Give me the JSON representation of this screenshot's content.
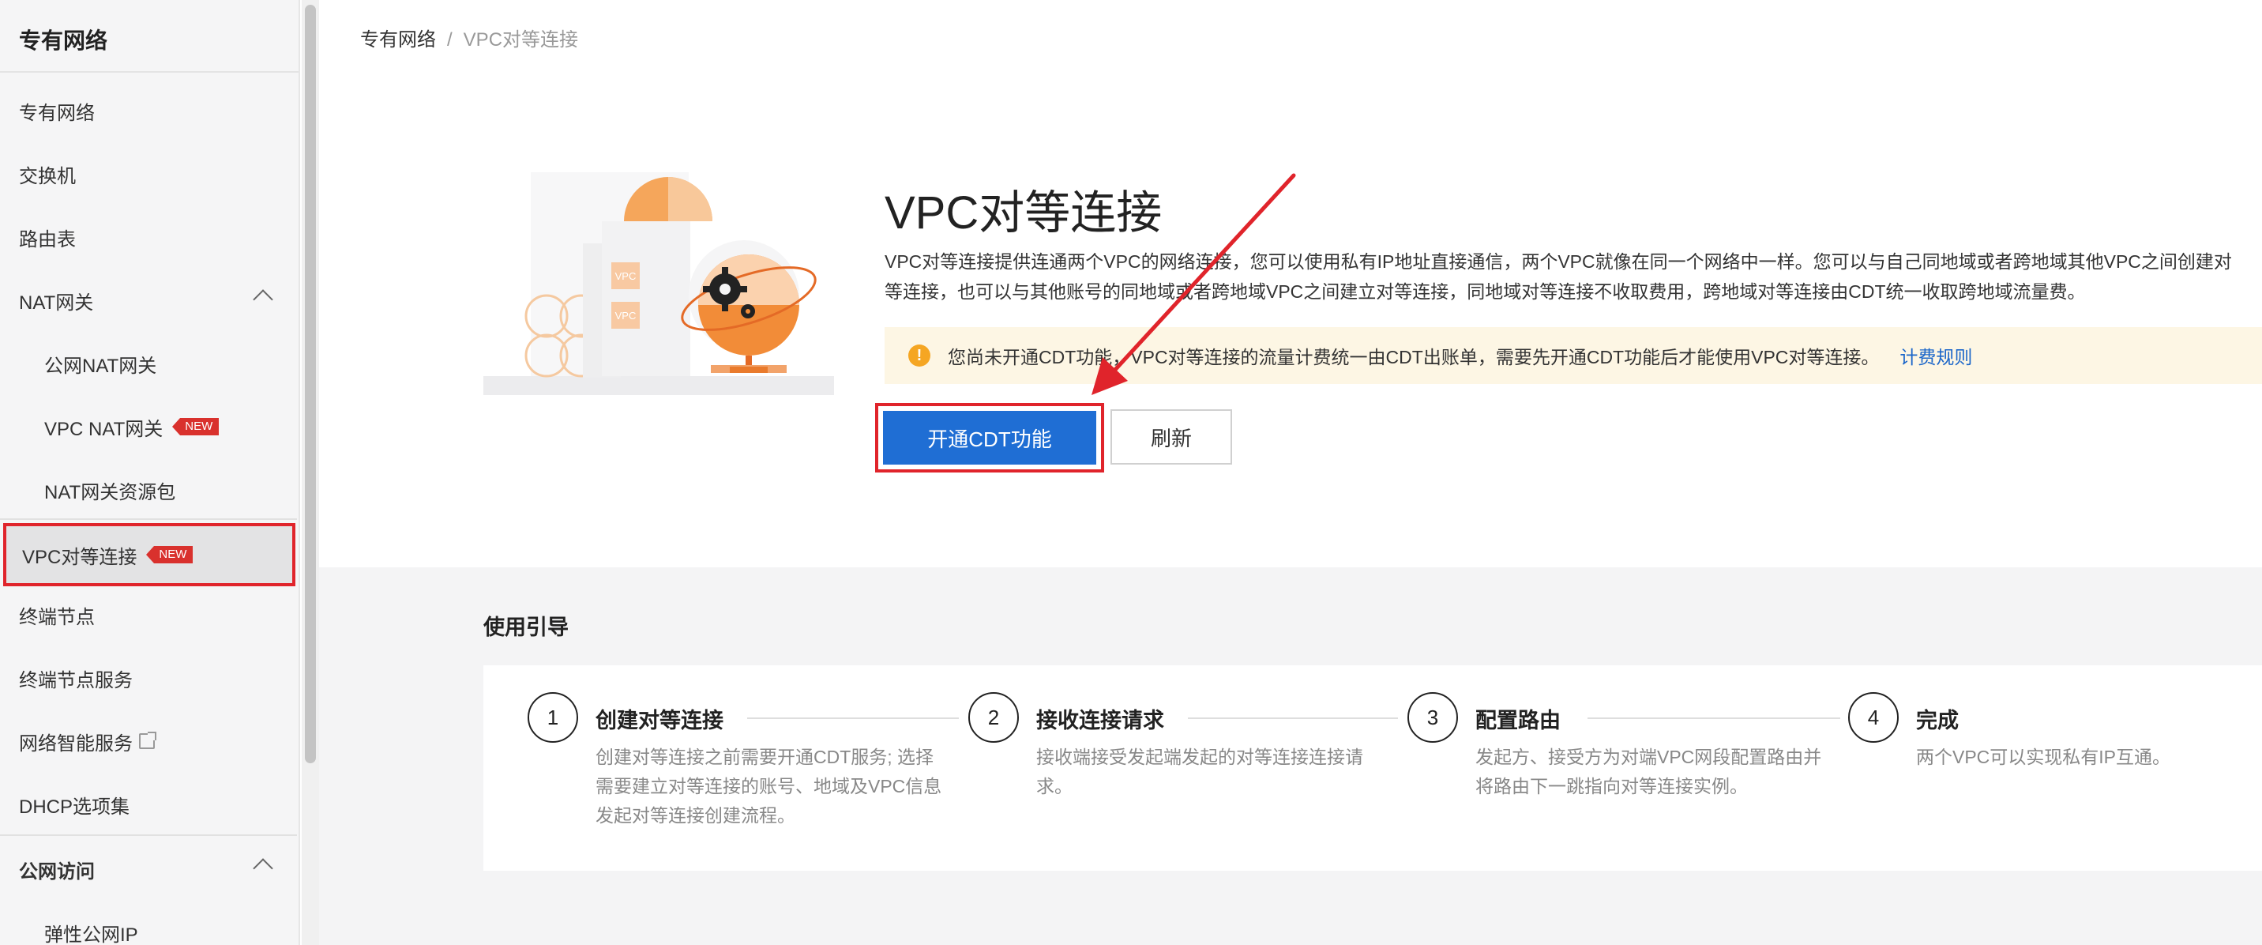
{
  "sidebar": {
    "title": "专有网络",
    "items": [
      {
        "label": "专有网络"
      },
      {
        "label": "交换机"
      },
      {
        "label": "路由表"
      },
      {
        "label": "NAT网关"
      },
      {
        "label": "公网NAT网关"
      },
      {
        "label": "VPC NAT网关",
        "badge": "NEW"
      },
      {
        "label": "NAT网关资源包"
      },
      {
        "label": "VPC对等连接",
        "badge": "NEW"
      },
      {
        "label": "终端节点"
      },
      {
        "label": "终端节点服务"
      },
      {
        "label": "网络智能服务"
      },
      {
        "label": "DHCP选项集"
      },
      {
        "label": "公网访问"
      },
      {
        "label": "弹性公网IP"
      }
    ]
  },
  "breadcrumb": {
    "root": "专有网络",
    "sep": "/",
    "current": "VPC对等连接"
  },
  "hero": {
    "title": "VPC对等连接",
    "desc_line1": "VPC对等连接提供连通两个VPC的网络连接，您可以使用私有IP地址直接通信，两个VPC就像在同一个网络中一样。您可以与自己同地域或者跨地域其他VPC之间创建对",
    "desc_line2": "等连接，也可以与其他账号的同地域或者跨地域VPC之间建立对等连接，同地域对等连接不收取费用，跨地域对等连接由CDT统一收取跨地域流量费。",
    "notice": "您尚未开通CDT功能，VPC对等连接的流量计费统一由CDT出账单，需要先开通CDT功能后才能使用VPC对等连接。",
    "notice_link": "计费规则",
    "primary_button": "开通CDT功能",
    "secondary_button": "刷新",
    "illustration_text": [
      "VPC",
      "VPC"
    ]
  },
  "guide": {
    "title": "使用引导",
    "steps": [
      {
        "num": "1",
        "title": "创建对等连接",
        "desc": "创建对等连接之前需要开通CDT服务; 选择需要建立对等连接的账号、地域及VPC信息发起对等连接创建流程。"
      },
      {
        "num": "2",
        "title": "接收连接请求",
        "desc": "接收端接受发起端发起的对等连接连接请求。"
      },
      {
        "num": "3",
        "title": "配置路由",
        "desc": "发起方、接受方为对端VPC网段配置路由并将路由下一跳指向对等连接实例。"
      },
      {
        "num": "4",
        "title": "完成",
        "desc": "两个VPC可以实现私有IP互通。"
      }
    ]
  },
  "colors": {
    "primary": "#1f6ed4",
    "highlight_red": "#e0242b",
    "badge_red": "#d9312d",
    "warning": "#f5a623",
    "link": "#1b66c9",
    "illustration_orange": "#f28c38"
  }
}
